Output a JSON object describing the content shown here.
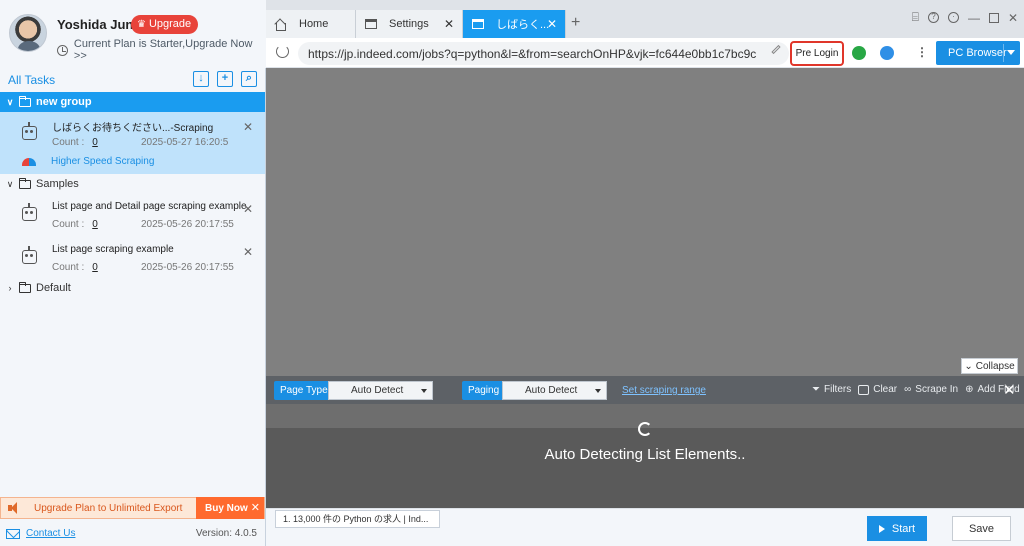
{
  "profile": {
    "username": "Yoshida Jun",
    "upgrade_label": "Upgrade",
    "plan_text": "Current Plan is Starter,Upgrade Now >>"
  },
  "tasks": {
    "title": "All Tasks",
    "groups": [
      {
        "name": "new group",
        "expanded": true,
        "items": [
          {
            "name": "しばらくお待ちください...-Scraping",
            "count_label": "Count :",
            "count": "0",
            "date": "2025-05-27 16:20:5",
            "extra": "Higher Speed Scraping"
          }
        ]
      },
      {
        "name": "Samples",
        "expanded": true,
        "items": [
          {
            "name": "List page and Detail page scraping example",
            "count_label": "Count :",
            "count": "0",
            "date": "2025-05-26 20:17:55"
          },
          {
            "name": "List page scraping example",
            "count_label": "Count :",
            "count": "0",
            "date": "2025-05-26 20:17:55"
          }
        ]
      },
      {
        "name": "Default",
        "expanded": false
      }
    ]
  },
  "promo": {
    "text": "Upgrade Plan to Unlimited Export",
    "buy_label": "Buy Now"
  },
  "footer": {
    "contact": "Contact Us",
    "version": "Version: 4.0.5"
  },
  "browser": {
    "tabs": [
      {
        "label": "Home",
        "active": false
      },
      {
        "label": "Settings",
        "active": false
      },
      {
        "label": "しばらく...",
        "active": true
      }
    ],
    "url": "https://jp.indeed.com/jobs?q=python&l=&from=searchOnHP&vjk=fc644e0bb1c7bc9c",
    "prelogin_label": "Pre Login",
    "mode_label": "PC Browser"
  },
  "toolbar": {
    "collapse_label": "Collapse",
    "page_type_label": "Page Type",
    "page_type_value": "Auto Detect",
    "paging_label": "Paging",
    "paging_value": "Auto Detect",
    "scraping_range_label": "Set scraping range",
    "filters_label": "Filters",
    "clear_label": "Clear",
    "scrape_in_label": "Scrape In",
    "add_field_label": "Add Field"
  },
  "detecting": {
    "message": "Auto Detecting List Elements.."
  },
  "bottom": {
    "page_tab": "1. 13,000 件の Python の求人 | Ind...",
    "start_label": "Start",
    "save_label": "Save"
  },
  "colors": {
    "accent": "#1a8fe3",
    "selected_bg": "#bfe2fb",
    "upgrade_red": "#e8433a",
    "buy_orange": "#ff6a2e"
  }
}
